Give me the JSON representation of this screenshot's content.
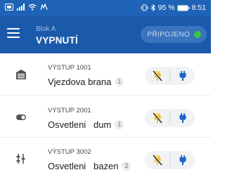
{
  "status_bar": {
    "battery_percent": "95 %",
    "time": "8:51",
    "icons": [
      "sim-card-icon",
      "signal-icon",
      "wifi-icon",
      "notification-icon",
      "vibrate-icon",
      "bluetooth-icon",
      "battery-icon"
    ]
  },
  "app_bar": {
    "subtitle": "Blok A",
    "title": "VYPNUTÍ",
    "connection_label": "PŘIPOJENO",
    "connection_color": "#3ec64a",
    "menu_icon": "hamburger-menu-icon"
  },
  "colors": {
    "status_bar": "#1e63b5",
    "app_bar": "#1b5aaa",
    "off_icon": "#f5bc1c",
    "on_icon": "#1d64c5"
  },
  "outputs": [
    {
      "category": "VÝSTUP 1001",
      "name": "Vjezdova brana",
      "count": "1",
      "icon": "gate-icon",
      "off_action": "power-off-icon",
      "on_action": "power-plug-icon"
    },
    {
      "category": "VÝSTUP 2001",
      "name": "Osvetleni   dum",
      "count": "1",
      "icon": "toggle-switch-icon",
      "off_action": "power-off-icon",
      "on_action": "power-plug-icon"
    },
    {
      "category": "VÝSTUP 3002",
      "name": "Osvetleni   bazen",
      "count": "2",
      "icon": "sliders-icon",
      "off_action": "power-off-icon",
      "on_action": "power-plug-icon"
    }
  ]
}
